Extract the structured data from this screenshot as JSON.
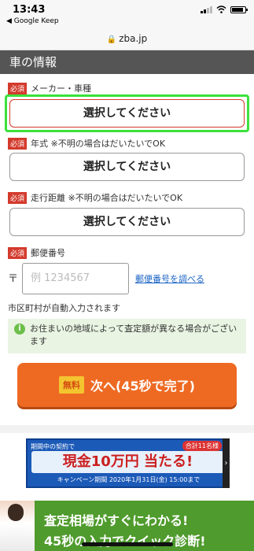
{
  "status_bar": {
    "time": "13:43",
    "back_app": "◀ Google Keep"
  },
  "browser": {
    "url": "zba.jp"
  },
  "section": {
    "title": "車の情報"
  },
  "form": {
    "required_tag": "必須",
    "maker": {
      "label": "メーカー・車種",
      "button": "選択してください"
    },
    "year": {
      "label": "年式 ※不明の場合はだいたいでOK",
      "button": "選択してください"
    },
    "mileage": {
      "label": "走行距離 ※不明の場合はだいたいでOK",
      "button": "選択してください"
    },
    "zip": {
      "label": "郵便番号",
      "mark": "〒",
      "placeholder": "例 1234567",
      "lookup_link": "郵便番号を調べる"
    },
    "auto_fill_note": "市区町村が自動入力されます",
    "info_notice": "お住まいの地域によって査定額が異なる場合がございます",
    "next_button": {
      "free_badge": "無料",
      "label": "次へ(45秒で完了)"
    }
  },
  "banner": {
    "top_text": "期間中の契約で",
    "count_text": "合計11名様",
    "main_text": "現金10万円 当たる!",
    "period_text": "キャンペーン期間 2020年1月31日(金) 15:00まで",
    "arrow": "›"
  },
  "footer": {
    "line1": "査定相場がすぐにわかる!",
    "line2": "45秒の入力でクイック診断!"
  },
  "colors": {
    "accent_orange": "#ee6a23",
    "required_red": "#d33a2c",
    "highlight_green": "#3ce13c",
    "footer_green": "#4f9b2d"
  }
}
